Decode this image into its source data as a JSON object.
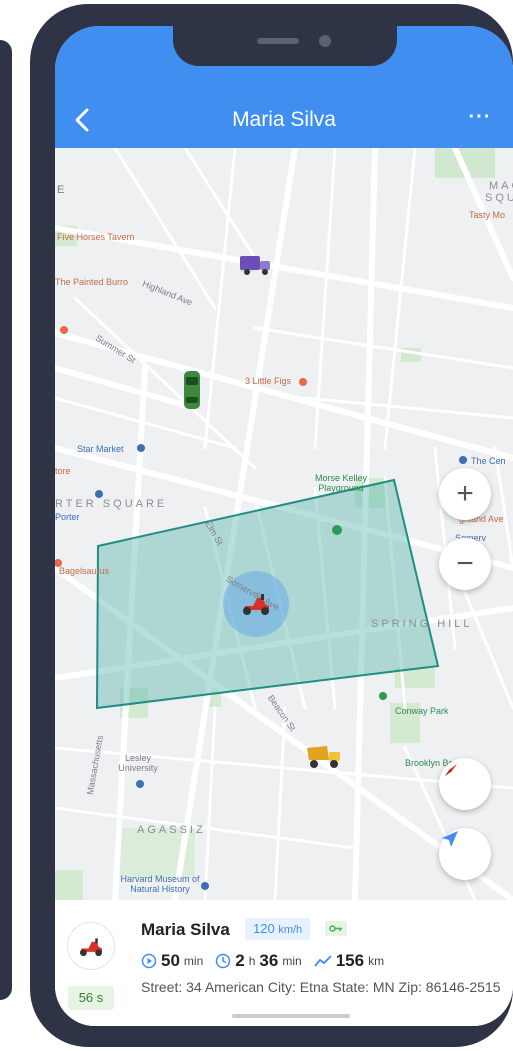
{
  "header": {
    "title": "Maria Silva",
    "more_label": "···"
  },
  "map": {
    "labels": {
      "five_horses": "Five Horses Tavern",
      "painted_burro": "The Painted Burro",
      "little_figs": "3 Little Figs",
      "star_market": "Star Market",
      "porter_square": "RTER SQUARE",
      "porter": "Porter",
      "morse_kelley": "Morse Kelley Playground",
      "spring_hill": "SPRING HILL",
      "bagelsaurus": "Bagelsaurus",
      "conway_park": "Conway Park",
      "lesley": "Lesley University",
      "agassiz": "AGASSIZ",
      "harvard_museum": "Harvard Museum of Natural History",
      "brooklyn": "Brooklyn Boulder",
      "somerv": "Somerv",
      "the_cen": "The Cen",
      "tasty_mo": "Tasty Mo",
      "mac_squ_1": "MAC",
      "mac_squ_2": "SQU",
      "highland_ave": "Highland Ave",
      "summer_st": "Summer St",
      "elm_st": "Elm St",
      "somerville_ave": "Somerville Ave",
      "beacon_st": "Beacon St",
      "massachusetts": "Massachusetts",
      "e": "E",
      "tore": "tore",
      "ghland_ave": "ghland Ave"
    },
    "controls": {
      "zoom_in": "+",
      "zoom_out": "−"
    },
    "colors": {
      "geofence_fill": "#5fb8b0",
      "geofence_stroke": "#1f8e84",
      "accent": "#3f8ef0"
    }
  },
  "vehicle_panel": {
    "name": "Maria Silva",
    "speed_value": "120",
    "speed_unit": "km/h",
    "age_badge": "56 s",
    "duration_min_value": "50",
    "duration_min_unit": "min",
    "time_h_value": "2",
    "time_h_unit": "h",
    "time_m_value": "36",
    "time_m_unit": "min",
    "distance_value": "156",
    "distance_unit": "km",
    "address": "Street: 34 American City: Etna State: MN Zip: 86146-2515"
  }
}
